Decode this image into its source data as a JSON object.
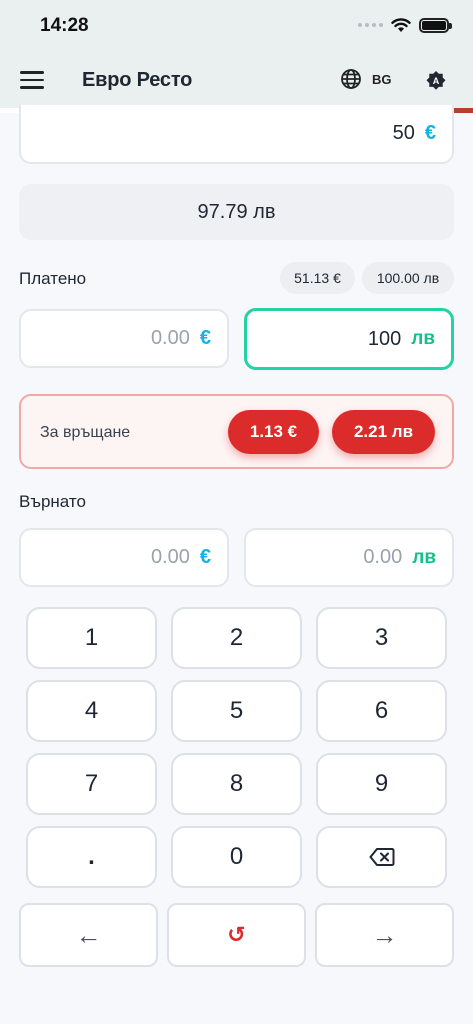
{
  "status_bar": {
    "time": "14:28"
  },
  "app_bar": {
    "title": "Евро Ресто",
    "language": "BG"
  },
  "amount": {
    "value": "50",
    "currency_symbol": "€"
  },
  "total": {
    "text": "97.79 лв"
  },
  "paid": {
    "label": "Платено",
    "chip_eur": "51.13 €",
    "chip_bgn": "100.00 лв",
    "eur_field": {
      "placeholder": "0.00",
      "symbol": "€"
    },
    "bgn_field": {
      "value": "100",
      "symbol": "лв"
    }
  },
  "change_due": {
    "label": "За връщане",
    "eur": "1.13 €",
    "bgn": "2.21 лв"
  },
  "returned": {
    "label": "Върнато",
    "eur_field": {
      "placeholder": "0.00",
      "symbol": "€"
    },
    "bgn_field": {
      "placeholder": "0.00",
      "symbol": "лв"
    }
  },
  "keypad": {
    "keys": [
      "1",
      "2",
      "3",
      "4",
      "5",
      "6",
      "7",
      "8",
      "9",
      ".",
      "0"
    ],
    "backspace_icon": "backspace-icon"
  },
  "nav": {
    "prev": "←",
    "reset": "↺",
    "next": "→"
  },
  "colors": {
    "accent_eur": "#13b2e6",
    "accent_bgn": "#14c18b",
    "alert_red": "#dc2b2b",
    "active_border": "#22d3a5"
  }
}
